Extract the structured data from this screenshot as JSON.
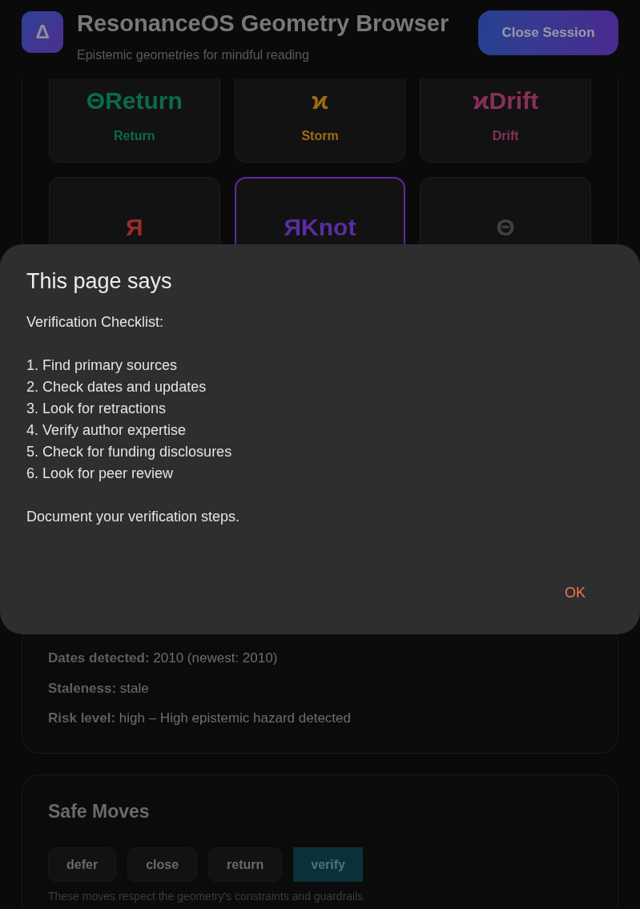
{
  "header": {
    "logo": "Δ",
    "title": "ResonanceOS Geometry Browser",
    "subtitle": "Epistemic geometries for mindful reading",
    "close_button": "Close Session"
  },
  "geometries": [
    {
      "glyph": "ΘReturn",
      "label": "Return",
      "color": "#0b6b4a",
      "selected": false
    },
    {
      "glyph": "ϰ",
      "label": "Storm",
      "color": "#a36a10",
      "selected": false
    },
    {
      "glyph": "ϰDrift",
      "label": "Drift",
      "color": "#8b2f5b",
      "selected": false
    },
    {
      "glyph": "Я",
      "color": "#9b2b2b",
      "selected": false
    },
    {
      "glyph": "ЯKnot",
      "color": "#5b2ca0",
      "selected": true
    },
    {
      "glyph": "Θ",
      "color": "#404040",
      "selected": false
    }
  ],
  "details": [
    {
      "label": "Dates detected:",
      "value": "2010 (newest: 2010)"
    },
    {
      "label": "Staleness:",
      "value": "stale"
    },
    {
      "label": "Risk level:",
      "value": "high – High epistemic hazard detected"
    }
  ],
  "safe_moves": {
    "title": "Safe Moves",
    "moves": [
      {
        "label": "defer",
        "selected": false
      },
      {
        "label": "close",
        "selected": false
      },
      {
        "label": "return",
        "selected": false
      },
      {
        "label": "verify",
        "selected": true
      }
    ],
    "note": "These moves respect the geometry's constraints and guardrails."
  },
  "dialog": {
    "title": "This page says",
    "intro": "Verification Checklist:",
    "steps": [
      "1. Find primary sources",
      "2. Check dates and updates",
      "3. Look for retractions",
      "4. Verify author expertise",
      "5. Check for funding disclosures",
      "6. Look for peer review"
    ],
    "closing": "Document your verification steps.",
    "ok_button": "OK"
  }
}
